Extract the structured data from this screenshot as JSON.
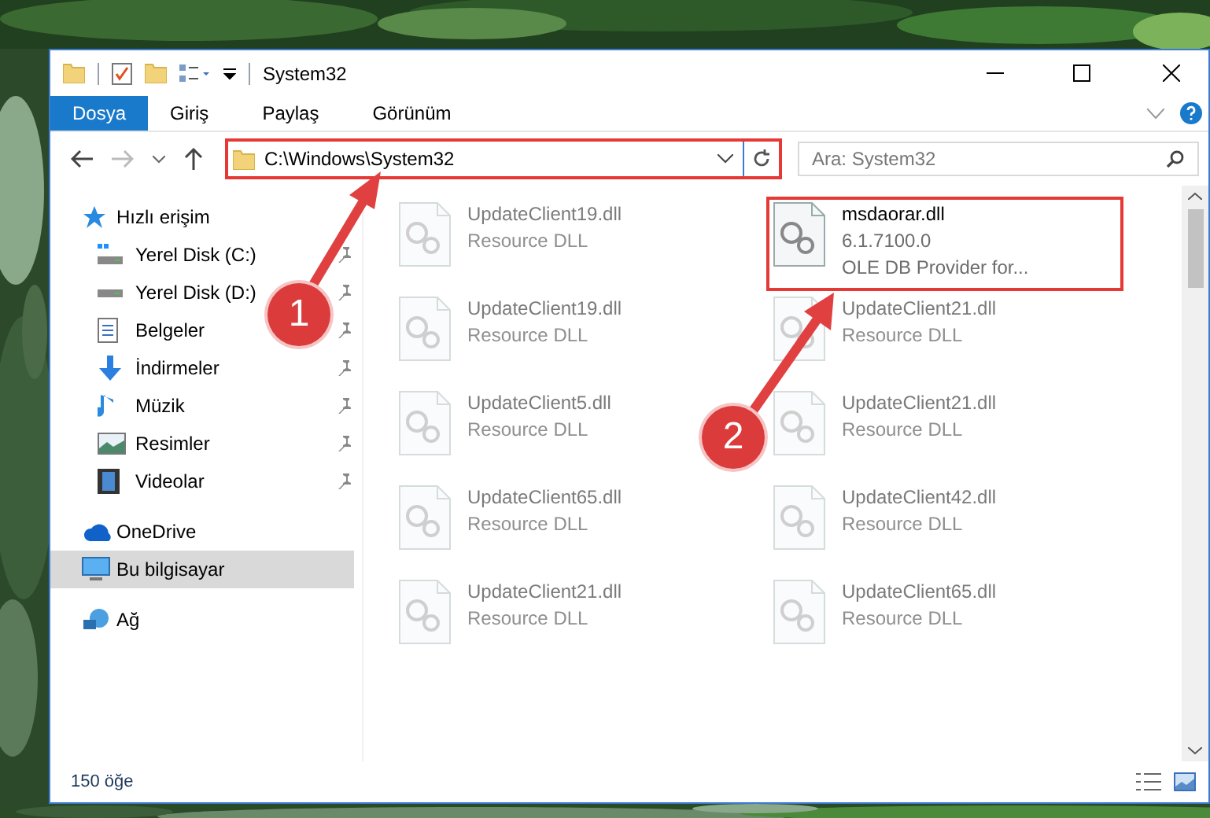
{
  "window": {
    "title": "System32"
  },
  "ribbon_tabs": [
    {
      "label": "Dosya",
      "kind": "file"
    },
    {
      "label": "Giriş",
      "kind": "tab"
    },
    {
      "label": "Paylaş",
      "kind": "tab"
    },
    {
      "label": "Görünüm",
      "kind": "tab"
    }
  ],
  "address": {
    "path": "C:\\Windows\\System32"
  },
  "search": {
    "placeholder": "Ara: System32"
  },
  "sidebar": {
    "items": [
      {
        "label": "Hızlı erişim",
        "selected": false,
        "children": [
          {
            "label": "Yerel Disk (C:)",
            "pinned": true
          },
          {
            "label": "Yerel Disk (D:)",
            "pinned": true
          },
          {
            "label": "Belgeler",
            "pinned": true
          },
          {
            "label": "İndirmeler",
            "pinned": true
          },
          {
            "label": "Müzik",
            "pinned": true
          },
          {
            "label": "Resimler",
            "pinned": true
          },
          {
            "label": "Videolar",
            "pinned": true
          }
        ]
      },
      {
        "label": "OneDrive",
        "selected": false
      },
      {
        "label": "Bu bilgisayar",
        "selected": true
      },
      {
        "label": "Ağ",
        "selected": false
      }
    ]
  },
  "files": [
    {
      "name": "UpdateClient19.dll",
      "lines": [
        "Resource DLL"
      ],
      "blurred": true
    },
    {
      "name": "msdaorar.dll",
      "lines": [
        "6.1.7100.0",
        "OLE DB Provider for..."
      ],
      "blurred": false
    },
    {
      "name": "UpdateClient19.dll",
      "lines": [
        "Resource DLL"
      ],
      "blurred": true
    },
    {
      "name": "UpdateClient21.dll",
      "lines": [
        "Resource DLL"
      ],
      "blurred": true
    },
    {
      "name": "UpdateClient5.dll",
      "lines": [
        "Resource DLL"
      ],
      "blurred": true
    },
    {
      "name": "UpdateClient21.dll",
      "lines": [
        "Resource DLL"
      ],
      "blurred": true
    },
    {
      "name": "UpdateClient65.dll",
      "lines": [
        "Resource DLL"
      ],
      "blurred": true
    },
    {
      "name": "UpdateClient42.dll",
      "lines": [
        "Resource DLL"
      ],
      "blurred": true
    },
    {
      "name": "UpdateClient21.dll",
      "lines": [
        "Resource DLL"
      ],
      "blurred": true
    },
    {
      "name": "UpdateClient65.dll",
      "lines": [
        "Resource DLL"
      ],
      "blurred": true
    }
  ],
  "status_bar": {
    "count": "150 öğe"
  },
  "annotations": [
    {
      "label": "1"
    },
    {
      "label": "2"
    }
  ]
}
